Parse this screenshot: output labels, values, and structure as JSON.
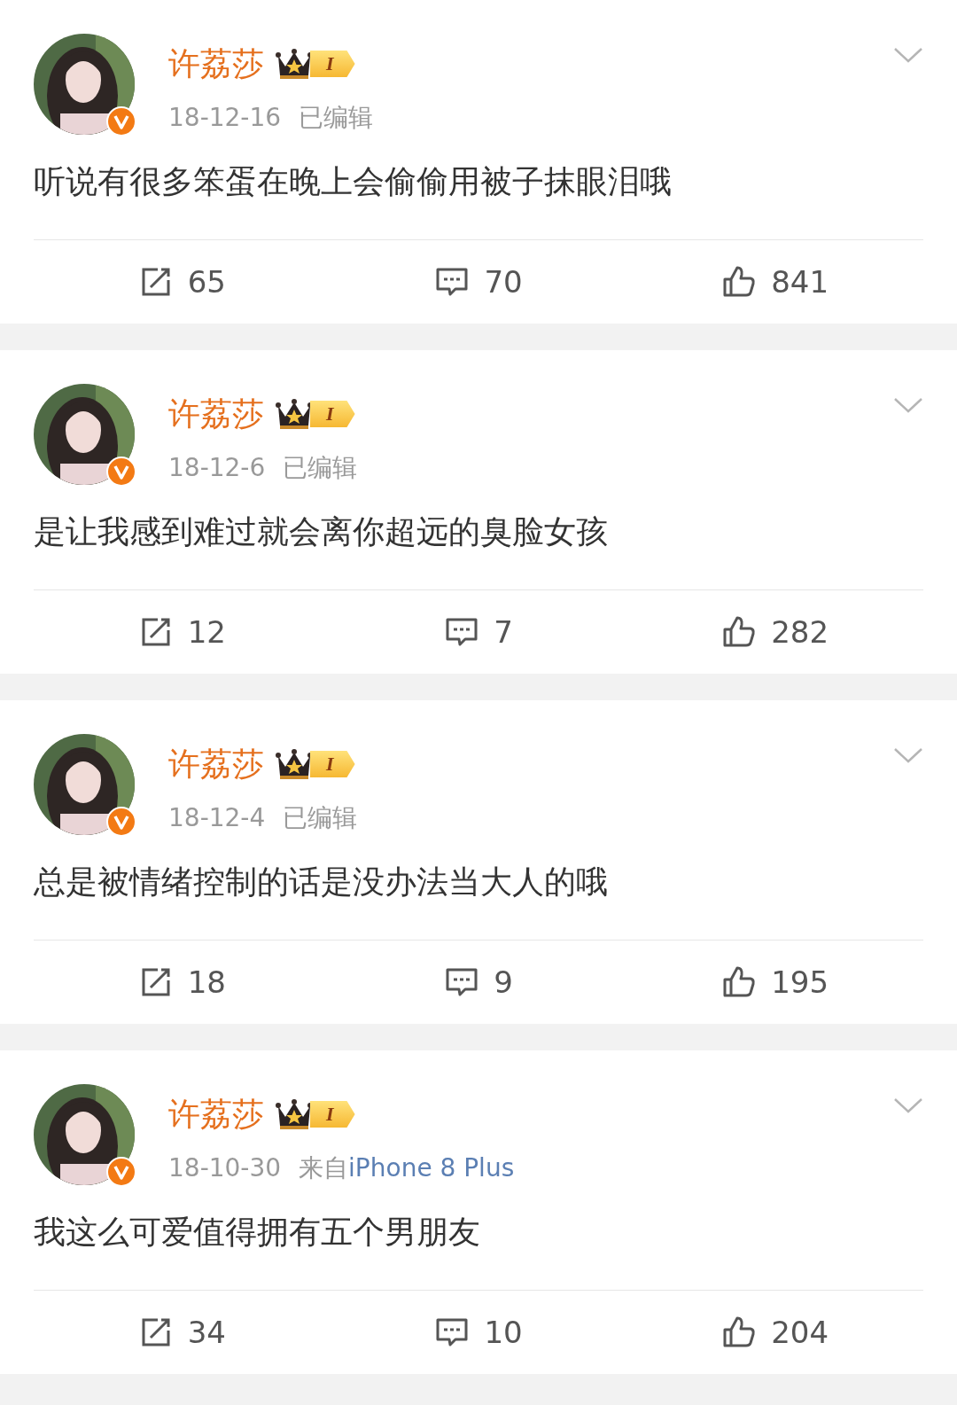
{
  "posts": [
    {
      "author": "许荔莎",
      "level": "I",
      "date": "18-12-16",
      "meta": {
        "kind": "edited",
        "text": "已编辑"
      },
      "content": "听说有很多笨蛋在晚上会偷偷用被子抹眼泪哦",
      "reposts": "65",
      "comments": "70",
      "likes": "841"
    },
    {
      "author": "许荔莎",
      "level": "I",
      "date": "18-12-6",
      "meta": {
        "kind": "edited",
        "text": "已编辑"
      },
      "content": "是让我感到难过就会离你超远的臭脸女孩",
      "reposts": "12",
      "comments": "7",
      "likes": "282"
    },
    {
      "author": "许荔莎",
      "level": "I",
      "date": "18-12-4",
      "meta": {
        "kind": "edited",
        "text": "已编辑"
      },
      "content": "总是被情绪控制的话是没办法当大人的哦",
      "reposts": "18",
      "comments": "9",
      "likes": "195"
    },
    {
      "author": "许荔莎",
      "level": "I",
      "date": "18-10-30",
      "meta": {
        "kind": "source",
        "prefix": "来自",
        "text": "iPhone 8 Plus"
      },
      "content": "我这么可爱值得拥有五个男朋友",
      "reposts": "34",
      "comments": "10",
      "likes": "204"
    }
  ]
}
